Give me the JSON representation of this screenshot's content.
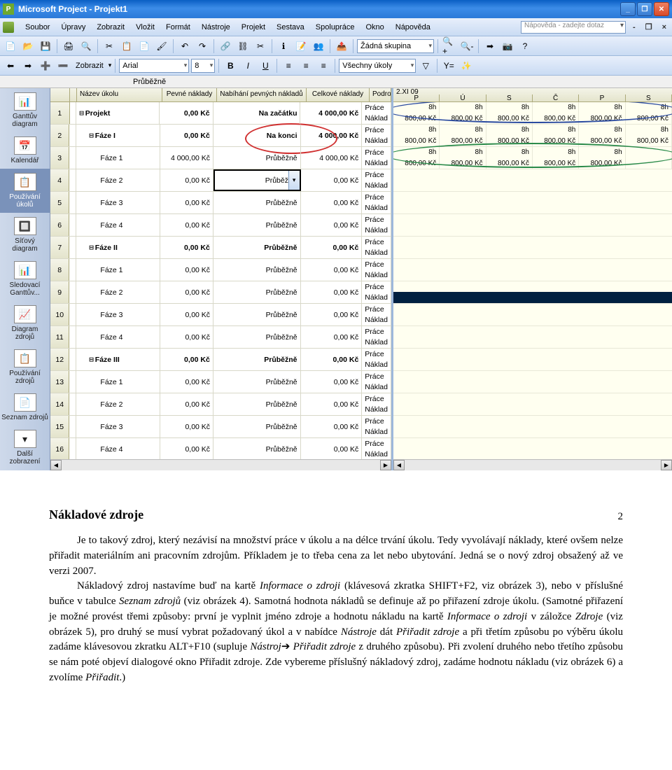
{
  "window": {
    "title": "Microsoft Project - Projekt1"
  },
  "menu": {
    "items": [
      "Soubor",
      "Úpravy",
      "Zobrazit",
      "Vložit",
      "Formát",
      "Nástroje",
      "Projekt",
      "Sestava",
      "Spolupráce",
      "Okno",
      "Nápověda"
    ],
    "help_placeholder": "Nápověda - zadejte dotaz"
  },
  "toolbar1": {
    "group_label": "Žádná skupina"
  },
  "toolbar2": {
    "show_label": "Zobrazit",
    "font": "Arial",
    "size": "8",
    "filter": "Všechny úkoly"
  },
  "formula_value": "Průběžně",
  "viewbar": {
    "items": [
      {
        "label": "Ganttův diagram",
        "glyph": "📊"
      },
      {
        "label": "Kalendář",
        "glyph": "📅"
      },
      {
        "label": "Používání úkolů",
        "glyph": "📋"
      },
      {
        "label": "Síťový diagram",
        "glyph": "🔲"
      },
      {
        "label": "Sledovací Ganttův...",
        "glyph": "📊"
      },
      {
        "label": "Diagram zdrojů",
        "glyph": "📈"
      },
      {
        "label": "Používání zdrojů",
        "glyph": "📋"
      },
      {
        "label": "Seznam zdrojů",
        "glyph": "📄"
      },
      {
        "label": "Další zobrazení",
        "glyph": "▾"
      }
    ],
    "active_index": 2
  },
  "columns": {
    "id": "",
    "name": "Název úkolu",
    "pev": "Pevné náklady",
    "nab": "Nabíhání pevných nákladů",
    "cel": "Celkové náklady",
    "pod": "Podrobr"
  },
  "podrobr": {
    "l1": "Práce",
    "l2": "Náklad"
  },
  "rows": [
    {
      "id": "1",
      "name": "Projekt",
      "lvl": 0,
      "outline": "⊟",
      "bold": true,
      "pev": "0,00 Kč",
      "nab": "Na začátku",
      "cel": "4 000,00 Kč"
    },
    {
      "id": "2",
      "name": "Fáze I",
      "lvl": 1,
      "outline": "⊟",
      "bold": true,
      "pev": "0,00 Kč",
      "nab": "Na konci",
      "cel": "4 000,00 Kč"
    },
    {
      "id": "3",
      "name": "Fáze 1",
      "lvl": 2,
      "pev": "4 000,00 Kč",
      "nab": "Průběžně",
      "cel": "4 000,00 Kč"
    },
    {
      "id": "4",
      "name": "Fáze 2",
      "lvl": 2,
      "pev": "0,00 Kč",
      "nab": "Průběžně",
      "cel": "0,00 Kč",
      "editing": true
    },
    {
      "id": "5",
      "name": "Fáze 3",
      "lvl": 2,
      "pev": "0,00 Kč",
      "nab": "Průběžně",
      "cel": "0,00 Kč"
    },
    {
      "id": "6",
      "name": "Fáze 4",
      "lvl": 2,
      "pev": "0,00 Kč",
      "nab": "Průběžně",
      "cel": "0,00 Kč"
    },
    {
      "id": "7",
      "name": "Fáze II",
      "lvl": 1,
      "outline": "⊟",
      "bold": true,
      "pev": "0,00 Kč",
      "nab": "Průběžně",
      "cel": "0,00 Kč"
    },
    {
      "id": "8",
      "name": "Fáze 1",
      "lvl": 2,
      "pev": "0,00 Kč",
      "nab": "Průběžně",
      "cel": "0,00 Kč"
    },
    {
      "id": "9",
      "name": "Fáze 2",
      "lvl": 2,
      "pev": "0,00 Kč",
      "nab": "Průběžně",
      "cel": "0,00 Kč"
    },
    {
      "id": "10",
      "name": "Fáze 3",
      "lvl": 2,
      "pev": "0,00 Kč",
      "nab": "Průběžně",
      "cel": "0,00 Kč"
    },
    {
      "id": "11",
      "name": "Fáze 4",
      "lvl": 2,
      "pev": "0,00 Kč",
      "nab": "Průběžně",
      "cel": "0,00 Kč"
    },
    {
      "id": "12",
      "name": "Fáze III",
      "lvl": 1,
      "outline": "⊟",
      "bold": true,
      "pev": "0,00 Kč",
      "nab": "Průběžně",
      "cel": "0,00 Kč"
    },
    {
      "id": "13",
      "name": "Fáze 1",
      "lvl": 2,
      "pev": "0,00 Kč",
      "nab": "Průběžně",
      "cel": "0,00 Kč"
    },
    {
      "id": "14",
      "name": "Fáze 2",
      "lvl": 2,
      "pev": "0,00 Kč",
      "nab": "Průběžně",
      "cel": "0,00 Kč"
    },
    {
      "id": "15",
      "name": "Fáze 3",
      "lvl": 2,
      "pev": "0,00 Kč",
      "nab": "Průběžně",
      "cel": "0,00 Kč"
    },
    {
      "id": "16",
      "name": "Fáze 4",
      "lvl": 2,
      "pev": "0,00 Kč",
      "nab": "Průběžně",
      "cel": "0,00 Kč"
    }
  ],
  "timeline": {
    "date": "2.XI 09",
    "days": [
      "P",
      "Ú",
      "S",
      "Č",
      "P",
      "S"
    ],
    "rows": [
      {
        "hours": [
          "8h",
          "8h",
          "8h",
          "8h",
          "8h",
          "8h"
        ],
        "cost": [
          "800,00 Kč",
          "800,00 Kč",
          "800,00 Kč",
          "800,00 Kč",
          "800,00 Kč",
          "800,00 Kč"
        ]
      },
      {
        "hours": [
          "8h",
          "8h",
          "8h",
          "8h",
          "8h",
          "8h"
        ],
        "cost": [
          "800,00 Kč",
          "800,00 Kč",
          "800,00 Kč",
          "800,00 Kč",
          "800,00 Kč",
          "800,00 Kč"
        ]
      },
      {
        "hours": [
          "8h",
          "8h",
          "8h",
          "8h",
          "8h",
          ""
        ],
        "cost": [
          "800,00 Kč",
          "800,00 Kč",
          "800,00 Kč",
          "800,00 Kč",
          "800,00 Kč",
          ""
        ]
      }
    ]
  },
  "doc": {
    "heading": "Nákladové zdroje",
    "pagenum": "2",
    "p1": "Je to takový zdroj, který nezávisí na množství práce v úkolu a na délce trvání úkolu. Tedy vyvolávají náklady, které ovšem nelze přiřadit materiálním ani pracovním zdrojům. Příkladem je to třeba cena za let nebo ubytování. Jedná se o nový zdroj obsažený až ve verzi 2007.",
    "p2a": "Nákladový zdroj nastavíme buď na kartě ",
    "p2b": "Informace o zdroji",
    "p2c": " (klávesová zkratka SHIFT+F2, viz obrázek 3), nebo v příslušné buňce v tabulce ",
    "p2d": "Seznam zdrojů",
    "p2e": " (viz obrázek 4). Samotná hodnota nákladů se definuje až po přiřazení zdroje úkolu. (Samotné přiřazení je možné provést třemi způsoby: první je vyplnit jméno zdroje a hodnotu nákladu na kartě ",
    "p2f": "Informace o zdroji",
    "p2g": " v záložce ",
    "p2h": "Zdroje",
    "p2i": " (viz obrázek 5), pro druhý se musí vybrat požadovaný úkol a v nabídce ",
    "p2j": "Nástroje",
    "p2k": " dát ",
    "p2l": "Přiřadit zdroje",
    "p2m": " a při třetím způsobu po výběru úkolu zadáme klávesovou zkratku ALT+F10 (supluje ",
    "p2n": "Nástroj",
    "p2o": "➔ ",
    "p2p": "Přiřadit zdroje",
    "p2q": " z druhého způsobu). Při zvolení druhého nebo třetího způsobu se nám poté objeví dialogové okno Přiřadit zdroje. Zde vybereme příslušný nákladový zdroj, zadáme hodnotu nákladu (viz obrázek 6) a zvolíme ",
    "p2r": "Přiřadit",
    "p2s": ".)"
  }
}
